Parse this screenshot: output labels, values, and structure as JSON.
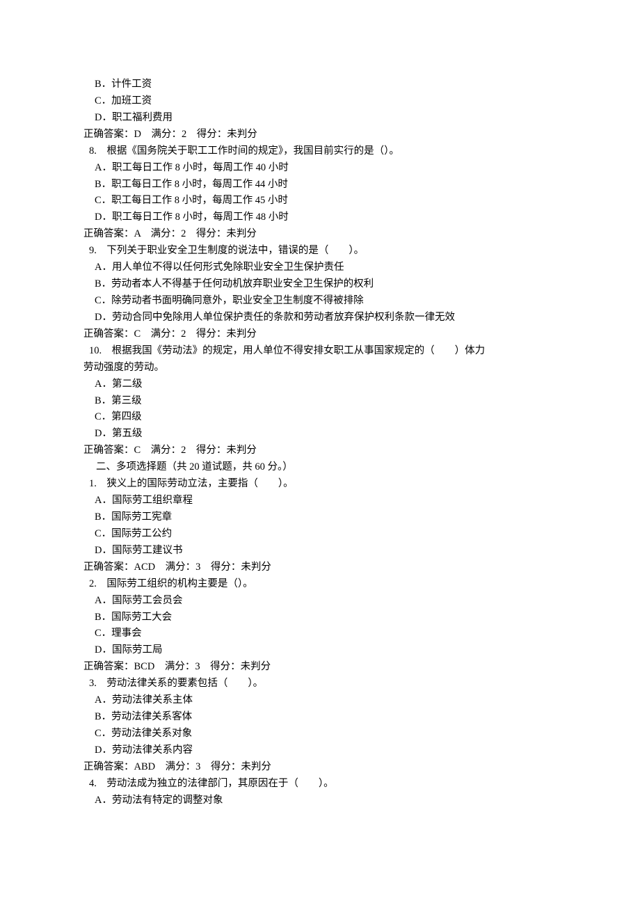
{
  "lines": [
    {
      "cls": "option",
      "text": "B．计件工资"
    },
    {
      "cls": "option",
      "text": "C．加班工资"
    },
    {
      "cls": "option",
      "text": "D．职工福利费用"
    },
    {
      "cls": "answer",
      "text": "正确答案：D　满分：2　得分：未判分"
    },
    {
      "cls": "question",
      "text": "8.　根据《国务院关于职工工作时间的规定》，我国目前实行的是（）。"
    },
    {
      "cls": "option",
      "text": "A．职工每日工作 8 小时，每周工作 40 小时"
    },
    {
      "cls": "option",
      "text": "B．职工每日工作 8 小时，每周工作 44 小时"
    },
    {
      "cls": "option",
      "text": "C．职工每日工作 8 小时，每周工作 45 小时"
    },
    {
      "cls": "option",
      "text": "D．职工每日工作 8 小时，每周工作 48 小时"
    },
    {
      "cls": "answer",
      "text": "正确答案：A　满分：2　得分：未判分"
    },
    {
      "cls": "question",
      "text": "9.　下列关于职业安全卫生制度的说法中，错误的是（　　）。"
    },
    {
      "cls": "option",
      "text": "A．用人单位不得以任何形式免除职业安全卫生保护责任"
    },
    {
      "cls": "option",
      "text": "B．劳动者本人不得基于任何动机放弃职业安全卫生保护的权利"
    },
    {
      "cls": "option",
      "text": "C．除劳动者书面明确同意外，职业安全卫生制度不得被排除"
    },
    {
      "cls": "option",
      "text": "D．劳动合同中免除用人单位保护责任的条款和劳动者放弃保护权利条款一律无效"
    },
    {
      "cls": "answer",
      "text": "正确答案：C　满分：2　得分：未判分"
    },
    {
      "cls": "question",
      "text": "10.　根据我国《劳动法》的规定，用人单位不得安排女职工从事国家规定的（　　）体力"
    },
    {
      "cls": "continuation",
      "text": "劳动强度的劳动。"
    },
    {
      "cls": "option",
      "text": "A．第二级"
    },
    {
      "cls": "option",
      "text": "B．第三级"
    },
    {
      "cls": "option",
      "text": "C．第四级"
    },
    {
      "cls": "option",
      "text": "D．第五级"
    },
    {
      "cls": "answer",
      "text": "正确答案：C　满分：2　得分：未判分"
    },
    {
      "cls": "section-h",
      "text": "二、多项选择题（共 20 道试题，共 60 分。）"
    },
    {
      "cls": "question",
      "text": "1.　狭义上的国际劳动立法，主要指（　　）。"
    },
    {
      "cls": "option",
      "text": "A．国际劳工组织章程"
    },
    {
      "cls": "option",
      "text": "B．国际劳工宪章"
    },
    {
      "cls": "option",
      "text": "C．国际劳工公约"
    },
    {
      "cls": "option",
      "text": "D．国际劳工建议书"
    },
    {
      "cls": "answer",
      "text": "正确答案：ACD　满分：3　得分：未判分"
    },
    {
      "cls": "question",
      "text": "2.　国际劳工组织的机构主要是（）。"
    },
    {
      "cls": "option",
      "text": "A．国际劳工会员会"
    },
    {
      "cls": "option",
      "text": "B．国际劳工大会"
    },
    {
      "cls": "option",
      "text": "C．理事会"
    },
    {
      "cls": "option",
      "text": "D．国际劳工局"
    },
    {
      "cls": "answer",
      "text": "正确答案：BCD　满分：3　得分：未判分"
    },
    {
      "cls": "question",
      "text": "3.　劳动法律关系的要素包括（　　）。"
    },
    {
      "cls": "option",
      "text": "A．劳动法律关系主体"
    },
    {
      "cls": "option",
      "text": "B．劳动法律关系客体"
    },
    {
      "cls": "option",
      "text": "C．劳动法律关系对象"
    },
    {
      "cls": "option",
      "text": "D．劳动法律关系内容"
    },
    {
      "cls": "answer",
      "text": "正确答案：ABD　满分：3　得分：未判分"
    },
    {
      "cls": "question",
      "text": "4.　劳动法成为独立的法律部门，其原因在于（　　）。"
    },
    {
      "cls": "option",
      "text": "A．劳动法有特定的调整对象"
    }
  ]
}
